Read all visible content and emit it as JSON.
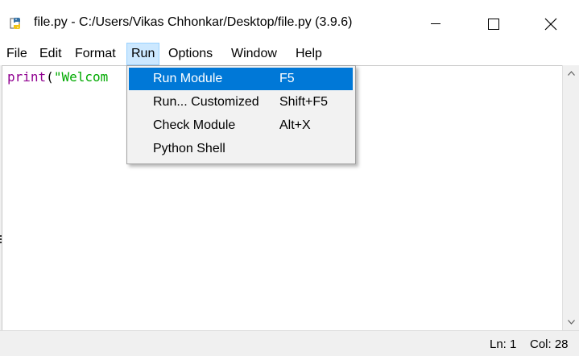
{
  "window": {
    "title": "file.py - C:/Users/Vikas Chhonkar/Desktop/file.py (3.9.6)",
    "icon": "python-idle-icon"
  },
  "menubar": {
    "items": [
      {
        "label": "File"
      },
      {
        "label": "Edit"
      },
      {
        "label": "Format"
      },
      {
        "label": "Run",
        "active": true
      },
      {
        "label": "Options"
      },
      {
        "label": "Window"
      },
      {
        "label": "Help"
      }
    ]
  },
  "run_menu": {
    "items": [
      {
        "label": "Run Module",
        "shortcut": "F5",
        "highlighted": true
      },
      {
        "label": "Run... Customized",
        "shortcut": "Shift+F5"
      },
      {
        "label": "Check Module",
        "shortcut": "Alt+X"
      },
      {
        "label": "Python Shell",
        "shortcut": ""
      }
    ]
  },
  "editor": {
    "code": {
      "builtin": "print",
      "open_paren": "(",
      "string_visible": "\"Welcom"
    }
  },
  "status": {
    "line": "Ln: 1",
    "column": "Col: 28"
  },
  "colors": {
    "builtin": "#900090",
    "string": "#00aa00",
    "menu_highlight": "#0078d7",
    "menubar_active": "#cce8ff"
  }
}
